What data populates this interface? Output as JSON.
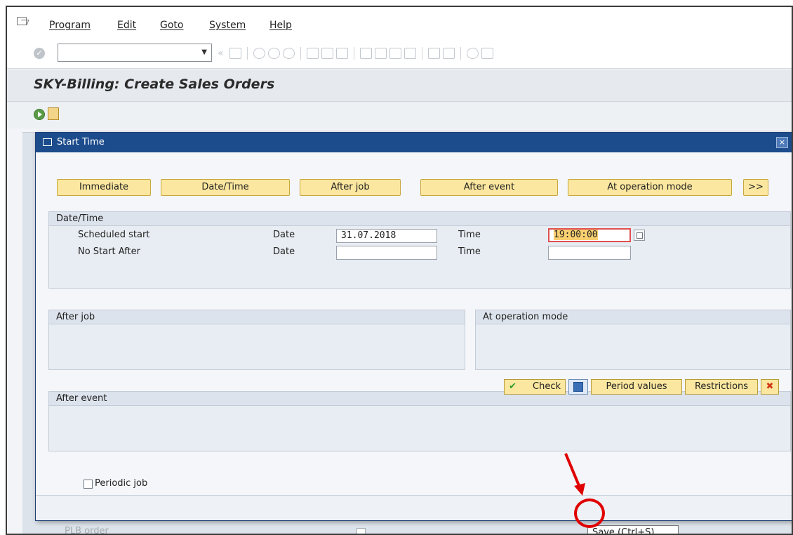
{
  "menu": {
    "items": [
      "Program",
      "Edit",
      "Goto",
      "System",
      "Help"
    ]
  },
  "toolbar": {
    "command_value": "",
    "icons": [
      "enter-icon",
      "save-icon",
      "back-icon",
      "exit-icon",
      "cancel-icon",
      "print-icon",
      "find-icon",
      "find-next-icon",
      "first-page-icon",
      "prev-page-icon",
      "next-page-icon",
      "last-page-icon",
      "new-session-icon",
      "shortcut-icon",
      "help-icon",
      "layout-icon"
    ]
  },
  "page": {
    "title": "SKY-Billing: Create Sales Orders"
  },
  "background": {
    "field_label": "PLB order"
  },
  "dialog": {
    "title": "Start Time",
    "close_label": "×",
    "buttons": [
      "Immediate",
      "Date/Time",
      "After job",
      "After event",
      "At operation mode",
      ">>"
    ],
    "datetime_group": {
      "title": "Date/Time",
      "rows": [
        {
          "label": "Scheduled start",
          "date_label": "Date",
          "date_value": "31.07.2018",
          "time_label": "Time",
          "time_value": "19:00:00"
        },
        {
          "label": "No Start After",
          "date_label": "Date",
          "date_value": "",
          "time_label": "Time",
          "time_value": ""
        }
      ]
    },
    "after_job_group": {
      "title": "After job"
    },
    "at_operation_mode_group": {
      "title": "At operation mode"
    },
    "after_event_group": {
      "title": "After event"
    },
    "periodic_job": {
      "label": "Periodic job",
      "checked": false
    },
    "footer": {
      "check_label": "Check",
      "save_tooltip": "Save  (Ctrl+S)",
      "period_values_label": "Period values",
      "restrictions_label": "Restrictions",
      "cancel_label": "✖"
    }
  },
  "colors": {
    "dialog_header": "#1d4c8c",
    "button_yellow": "#fbe79f",
    "highlight_red": "#e00000"
  }
}
